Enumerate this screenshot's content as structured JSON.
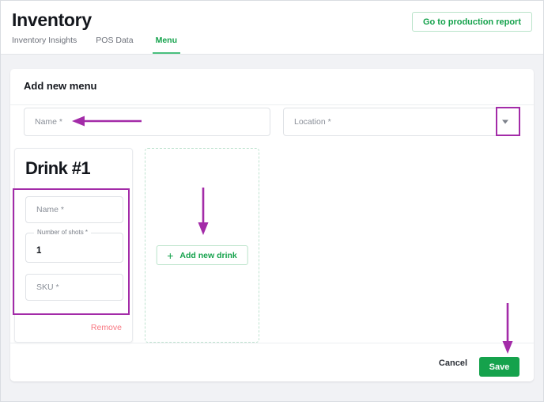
{
  "header": {
    "title": "Inventory",
    "production_report_button": "Go to production report",
    "tabs": [
      {
        "label": "Inventory Insights",
        "active": false
      },
      {
        "label": "POS Data",
        "active": false
      },
      {
        "label": "Menu",
        "active": true
      }
    ]
  },
  "main": {
    "card_title": "Add new menu",
    "menu_name": {
      "placeholder": "Name *",
      "value": ""
    },
    "location": {
      "placeholder": "Location *",
      "value": "",
      "icon": "chevron-down-icon"
    },
    "drink_card": {
      "heading": "Drink #1",
      "name": {
        "placeholder": "Name *",
        "value": ""
      },
      "shots": {
        "label": "Number of shots *",
        "value": "1"
      },
      "sku": {
        "placeholder": "SKU *",
        "value": ""
      },
      "remove_label": "Remove"
    },
    "add_drink_card": {
      "button_label": "Add new drink",
      "button_icon": "plus-icon"
    },
    "footer": {
      "cancel_label": "Cancel",
      "save_label": "Save"
    }
  },
  "colors": {
    "accent_green": "#15a24c",
    "tab_underline": "#48bf7d",
    "annotation_magenta": "#a32ba8",
    "remove_red": "#f87680",
    "page_background": "#f1f2f5"
  },
  "annotations": {
    "name_field_arrow": "arrow-pointing-left-to-name-field",
    "dropdown_box": "highlight-box-location-dropdown",
    "add_drink_arrow": "arrow-pointing-down-to-add-new-drink",
    "drink_fields_box": "highlight-box-drink-fields",
    "save_arrow": "arrow-pointing-down-to-save"
  }
}
